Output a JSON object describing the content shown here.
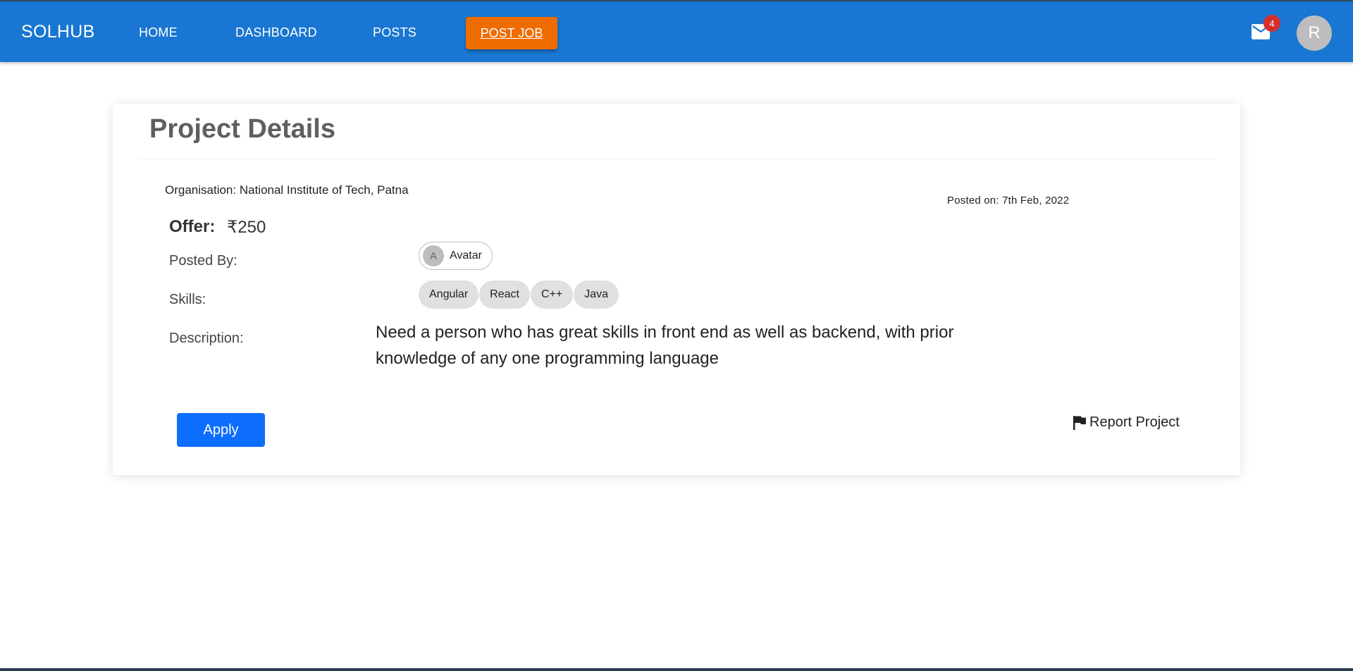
{
  "navbar": {
    "brand": "SOLHUB",
    "links": [
      "HOME",
      "DASHBOARD",
      "POSTS"
    ],
    "post_job": "POST JOB",
    "mail_badge": "4",
    "user_initial": "R",
    "color": "#1976d2",
    "post_job_color": "#ef6c00"
  },
  "project": {
    "title": "Project Details",
    "organisation": "Organisation: National Institute of Tech, Patna",
    "posted_on": "Posted on: 7th Feb, 2022",
    "offer_label": "Offer:",
    "offer_value": "₹250",
    "posted_by_label": "Posted By:",
    "posted_by_initial": "A",
    "posted_by_name": "Avatar",
    "skills_label": "Skills:",
    "skills": [
      "Angular",
      "React",
      "C++",
      "Java"
    ],
    "description_label": "Description:",
    "description": "Need a person who has great skills in front end as well as backend, with prior knowledge of any one programming language",
    "apply_label": "Apply",
    "report_label": "Report Project",
    "apply_color": "#0d6efd"
  }
}
